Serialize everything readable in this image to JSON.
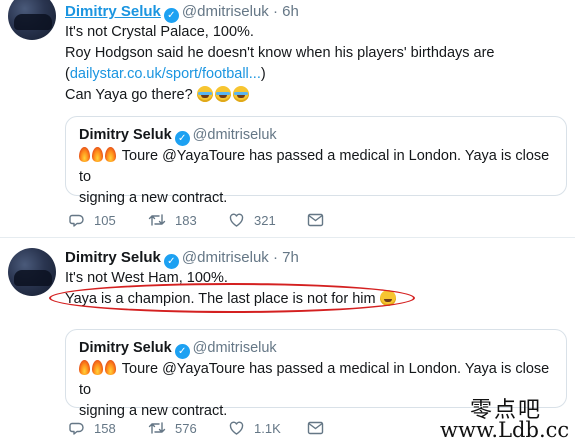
{
  "tweets": [
    {
      "author": "Dimitry Seluk",
      "handle": "@dmitriseluk",
      "time": "· 6h",
      "line1": "It's not Crystal Palace, 100%.",
      "line2": "Roy Hodgson said he doesn't know when his players' birthdays are",
      "line3_open": "(",
      "line3_link": "dailystar.co.uk/sport/football...",
      "line3_close": ")",
      "line4": "Can Yaya go there?",
      "quote": {
        "author": "Dimitry Seluk",
        "handle": "@dmitriseluk",
        "text1": "Toure @YayaToure has passed a medical in London. Yaya is close to",
        "text2": "signing a new contract."
      },
      "stats": {
        "replies": "105",
        "retweets": "183",
        "likes": "321"
      }
    },
    {
      "author": "Dimitry Seluk",
      "handle": "@dmitriseluk",
      "time": "· 7h",
      "line1": "It's not West Ham, 100%.",
      "line2": "Yaya is a champion. The last place is not for him",
      "quote": {
        "author": "Dimitry Seluk",
        "handle": "@dmitriseluk",
        "text1": "Toure @YayaToure has passed a medical in London. Yaya is close to",
        "text2": "signing a new contract."
      },
      "stats": {
        "replies": "158",
        "retweets": "576",
        "likes": "1.1K"
      }
    }
  ],
  "watermark": {
    "cn": "零点吧",
    "url": "www.Ldb.cc"
  },
  "colors": {
    "link": "#1b95e0",
    "muted": "#657786",
    "annotation": "#d42020"
  },
  "icons": [
    "verified-badge-icon",
    "reply-icon",
    "retweet-icon",
    "like-icon",
    "direct-message-icon",
    "laughing-crying-emoji-icon",
    "fire-emoji-icon",
    "grinning-emoji-icon"
  ]
}
